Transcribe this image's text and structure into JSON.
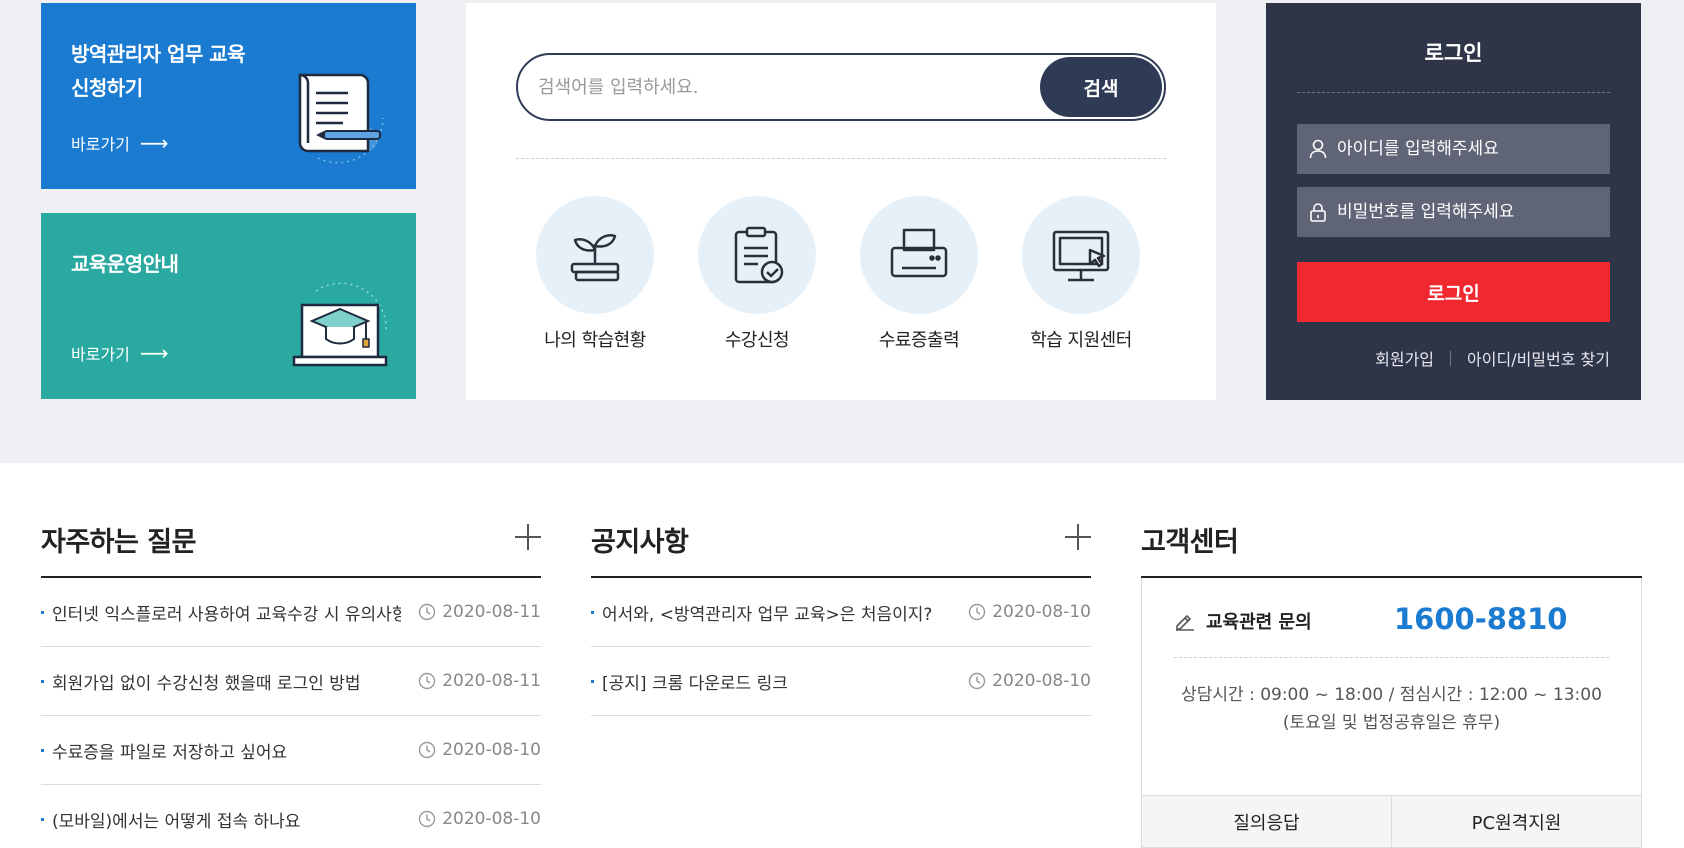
{
  "promos": [
    {
      "title": "방역관리자 업무 교육\n신청하기",
      "link": "바로가기"
    },
    {
      "title": "교육운영안내",
      "link": "바로가기"
    }
  ],
  "search": {
    "placeholder": "검색어를 입력하세요.",
    "button": "검색"
  },
  "quick_links": [
    {
      "label": "나의 학습현황",
      "icon": "plant-book-icon"
    },
    {
      "label": "수강신청",
      "icon": "clipboard-check-icon"
    },
    {
      "label": "수료증출력",
      "icon": "printer-icon"
    },
    {
      "label": "학습 지원센터",
      "icon": "monitor-cursor-icon"
    }
  ],
  "login": {
    "title": "로그인",
    "id_placeholder": "아이디를 입력해주세요",
    "pw_placeholder": "비밀번호를 입력해주세요",
    "button": "로그인",
    "signup": "회원가입",
    "find": "아이디/비밀번호 찾기"
  },
  "faq": {
    "title": "자주하는 질문",
    "items": [
      {
        "text": "인터넷 익스플로러 사용하여 교육수강 시 유의사항",
        "date": "2020-08-11"
      },
      {
        "text": "회원가입 없이 수강신청 했을때 로그인 방법",
        "date": "2020-08-11"
      },
      {
        "text": "수료증을 파일로 저장하고 싶어요",
        "date": "2020-08-10"
      },
      {
        "text": "(모바일)에서는 어떻게 접속 하나요",
        "date": "2020-08-10"
      }
    ]
  },
  "notice": {
    "title": "공지사항",
    "items": [
      {
        "text": "어서와, <방역관리자 업무 교육>은 처음이지?",
        "date": "2020-08-10"
      },
      {
        "text": "[공지] 크롬 다운로드 링크",
        "date": "2020-08-10"
      }
    ]
  },
  "customer_center": {
    "title": "고객센터",
    "inquiry_label": "교육관련 문의",
    "phone": "1600-8810",
    "hours_line1": "상담시간 : 09:00 ~ 18:00 / 점심시간 : 12:00 ~ 13:00",
    "hours_line2": "(토요일 및 법정공휴일은 휴무)",
    "tabs": [
      "질의응답",
      "PC원격지원"
    ]
  },
  "colors": {
    "accent_blue": "#1a7bd0",
    "teal": "#2aa9a1",
    "navy": "#2f3549",
    "login_red": "#f0282f"
  }
}
